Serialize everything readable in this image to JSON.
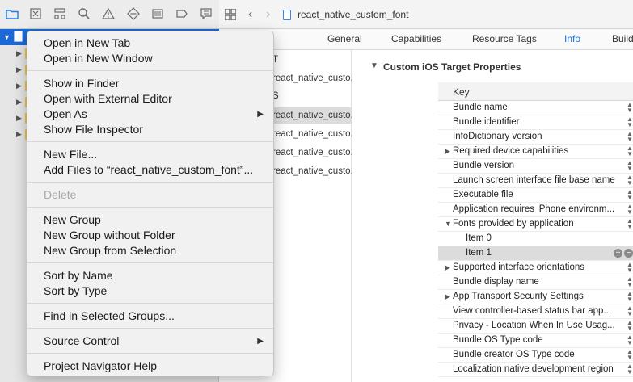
{
  "navigator": {
    "toolbar_icons": [
      "folder-icon",
      "source-control-icon",
      "hierarchy-icon",
      "search-icon",
      "warning-icon",
      "test-icon",
      "debug-icon",
      "breakpoint-icon",
      "report-icon"
    ]
  },
  "jumpbar": {
    "title": "react_native_custom_font"
  },
  "tabs": [
    "General",
    "Capabilities",
    "Resource Tags",
    "Info",
    "Build"
  ],
  "active_tab": "Info",
  "targets": {
    "partial_rows": [
      "T",
      "react_native_custo...",
      "S",
      "react_native_custo...",
      "react_native_custo...",
      "react_native_custo...",
      "react_native_custo..."
    ]
  },
  "info": {
    "section_title": "Custom iOS Target Properties",
    "key_header": "Key",
    "rows": [
      {
        "key": "Bundle name"
      },
      {
        "key": "Bundle identifier"
      },
      {
        "key": "InfoDictionary version"
      },
      {
        "key": "Required device capabilities",
        "expand": "right"
      },
      {
        "key": "Bundle version"
      },
      {
        "key": "Launch screen interface file base name"
      },
      {
        "key": "Executable file"
      },
      {
        "key": "Application requires iPhone environm..."
      },
      {
        "key": "Fonts provided by application",
        "expand": "down"
      },
      {
        "key": "Item 0",
        "child": true
      },
      {
        "key": "Item 1",
        "child": true,
        "selected": true
      },
      {
        "key": "Supported interface orientations",
        "expand": "right"
      },
      {
        "key": "Bundle display name"
      },
      {
        "key": "App Transport Security Settings",
        "expand": "right"
      },
      {
        "key": "View controller-based status bar app..."
      },
      {
        "key": "Privacy - Location When In Use Usag..."
      },
      {
        "key": "Bundle OS Type code"
      },
      {
        "key": "Bundle creator OS Type code"
      },
      {
        "key": "Localization native development region"
      }
    ]
  },
  "context_menu": {
    "groups": [
      [
        {
          "label": "Open in New Tab"
        },
        {
          "label": "Open in New Window"
        }
      ],
      [
        {
          "label": "Show in Finder"
        },
        {
          "label": "Open with External Editor"
        },
        {
          "label": "Open As",
          "submenu": true
        },
        {
          "label": "Show File Inspector"
        }
      ],
      [
        {
          "label": "New File..."
        },
        {
          "label": "Add Files to “react_native_custom_font”..."
        }
      ],
      [
        {
          "label": "Delete",
          "disabled": true
        }
      ],
      [
        {
          "label": "New Group"
        },
        {
          "label": "New Group without Folder"
        },
        {
          "label": "New Group from Selection"
        }
      ],
      [
        {
          "label": "Sort by Name"
        },
        {
          "label": "Sort by Type"
        }
      ],
      [
        {
          "label": "Find in Selected Groups..."
        }
      ],
      [
        {
          "label": "Source Control",
          "submenu": true
        }
      ],
      [
        {
          "label": "Project Navigator Help"
        }
      ]
    ]
  }
}
